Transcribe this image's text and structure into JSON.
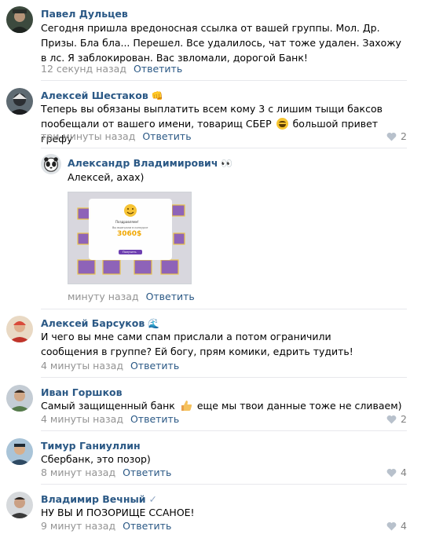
{
  "reply_label": "Ответить",
  "comments": [
    {
      "author": "Павел Дульцев",
      "text": "Сегодня пришла вредоносная ссылка от вашей группы. Мол. Др. Призы. Бла бла... Перешел. Все удалилось, чат тоже удален. Захожу в лс. Я заблокирован. Вас звломали, дорогой Банк!",
      "time": "12 секунд назад"
    },
    {
      "author": "Алексей Шестаков",
      "author_emoji": "👊",
      "text_part1": "Теперь вы обязаны выплатить всем кому 3 с лишим тыщи баксов пообещали от вашего имени, товарищ СБЕР",
      "text_part2": "большой привет грефу",
      "time": "три минуты назад",
      "likes": "2"
    },
    {
      "author": "Александр Владимирович",
      "author_emoji": "👀",
      "text": "Алексей, ахах)",
      "time": "минуту назад",
      "attachment": {
        "heading": "Поздравляем!",
        "subheading": "Вы выиграли в конкурсе",
        "amount": "3060$",
        "button_label": "Получить"
      }
    },
    {
      "author": "Алексей Барсуков",
      "author_emoji": "🌊",
      "text": "И чего вы мне сами спам прислали а потом ограничили сообщения в группе? Ей богу, прям комики, едрить тудить!",
      "time": "4 минуты назад"
    },
    {
      "author": "Иван Горшков",
      "text_part1": "Самый защищенный банк",
      "text_part2": "еще мы твои данные тоже не сливаем)",
      "time": "4 минуты назад",
      "likes": "2"
    },
    {
      "author": "Тимур Ганиуллин",
      "text": "Сбербанк, это позор)",
      "time": "8 минут назад",
      "likes": "4"
    },
    {
      "author": "Владимир Вечный",
      "author_badge": "✓",
      "text": "НУ ВЫ И ПОЗОРИЩЕ ССАНОЕ!",
      "time": "9 минут назад",
      "likes": "4"
    }
  ],
  "colors": {
    "author_link": "#2a5885",
    "meta_gray": "#939393",
    "divider": "#e7e8ec"
  }
}
